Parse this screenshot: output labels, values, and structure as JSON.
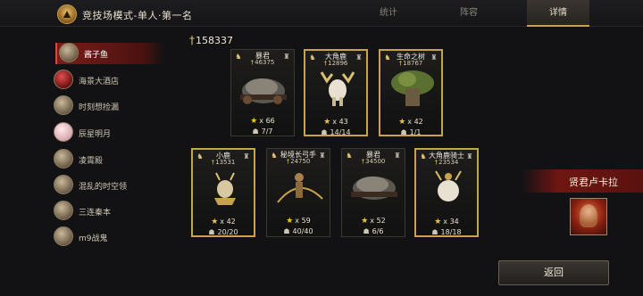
{
  "header": {
    "title": "竞技场模式-单人·第一名",
    "tabs": {
      "stats": "统计",
      "lineup": "阵容",
      "details": "详情"
    }
  },
  "sidebar": {
    "players": [
      {
        "name": "酱子鱼",
        "active": true
      },
      {
        "name": "海景大酒店"
      },
      {
        "name": "时刻想捡漏"
      },
      {
        "name": "辰星明月"
      },
      {
        "name": "凌霄殿"
      },
      {
        "name": "混乱的时空领"
      },
      {
        "name": "三连秦本"
      },
      {
        "name": "m9战鬼"
      }
    ]
  },
  "total_power": "158337",
  "cards": {
    "row1": [
      {
        "name": "暴君",
        "power": "46375",
        "stars": "x 66",
        "troops": "7/7"
      },
      {
        "name": "大角鹿",
        "power": "12896",
        "stars": "x 43",
        "troops": "14/14"
      },
      {
        "name": "生命之树",
        "power": "18767",
        "stars": "x 42",
        "troops": "1/1"
      }
    ],
    "row2": [
      {
        "name": "小鹿",
        "power": "13531",
        "stars": "x 42",
        "troops": "20/20"
      },
      {
        "name": "秘境长弓手",
        "power": "24750",
        "stars": "x 59",
        "troops": "40/40"
      },
      {
        "name": "暴君",
        "power": "34500",
        "stars": "x 52",
        "troops": "6/6"
      },
      {
        "name": "大角鹿骑士",
        "power": "23534",
        "stars": "x 34",
        "troops": "18/18"
      }
    ]
  },
  "hero": {
    "name": "贤君卢卡拉",
    "icon": "hero-portrait"
  },
  "footer": {
    "back": "返回"
  },
  "colors": {
    "gold": "#c9a24c",
    "red": "#7a1c18",
    "star": "#f1c13d"
  }
}
